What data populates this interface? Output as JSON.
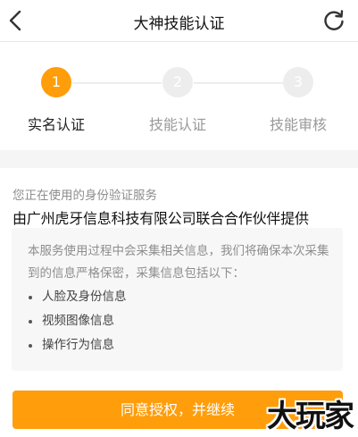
{
  "header": {
    "title": "大神技能认证",
    "back_icon": "chevron-left-icon",
    "refresh_icon": "refresh-icon"
  },
  "steps": [
    {
      "number": "1",
      "label": "实名认证",
      "active": true
    },
    {
      "number": "2",
      "label": "技能认证",
      "active": false
    },
    {
      "number": "3",
      "label": "技能审核",
      "active": false
    }
  ],
  "verification": {
    "subtitle": "您正在使用的身份验证服务",
    "provider": "由广州虎牙信息科技有限公司联合合作伙伴提供",
    "description": "本服务使用过程中会采集相关信息，我们将确保本次采集到的信息严格保密，采集信息包括以下：",
    "items": [
      "人脸及身份信息",
      "视频图像信息",
      "操作行为信息"
    ]
  },
  "agree_button": "同意授权，并继续",
  "watermark": "大玩家",
  "colors": {
    "accent": "#ff9d0a",
    "inactive_step": "#ededed"
  }
}
